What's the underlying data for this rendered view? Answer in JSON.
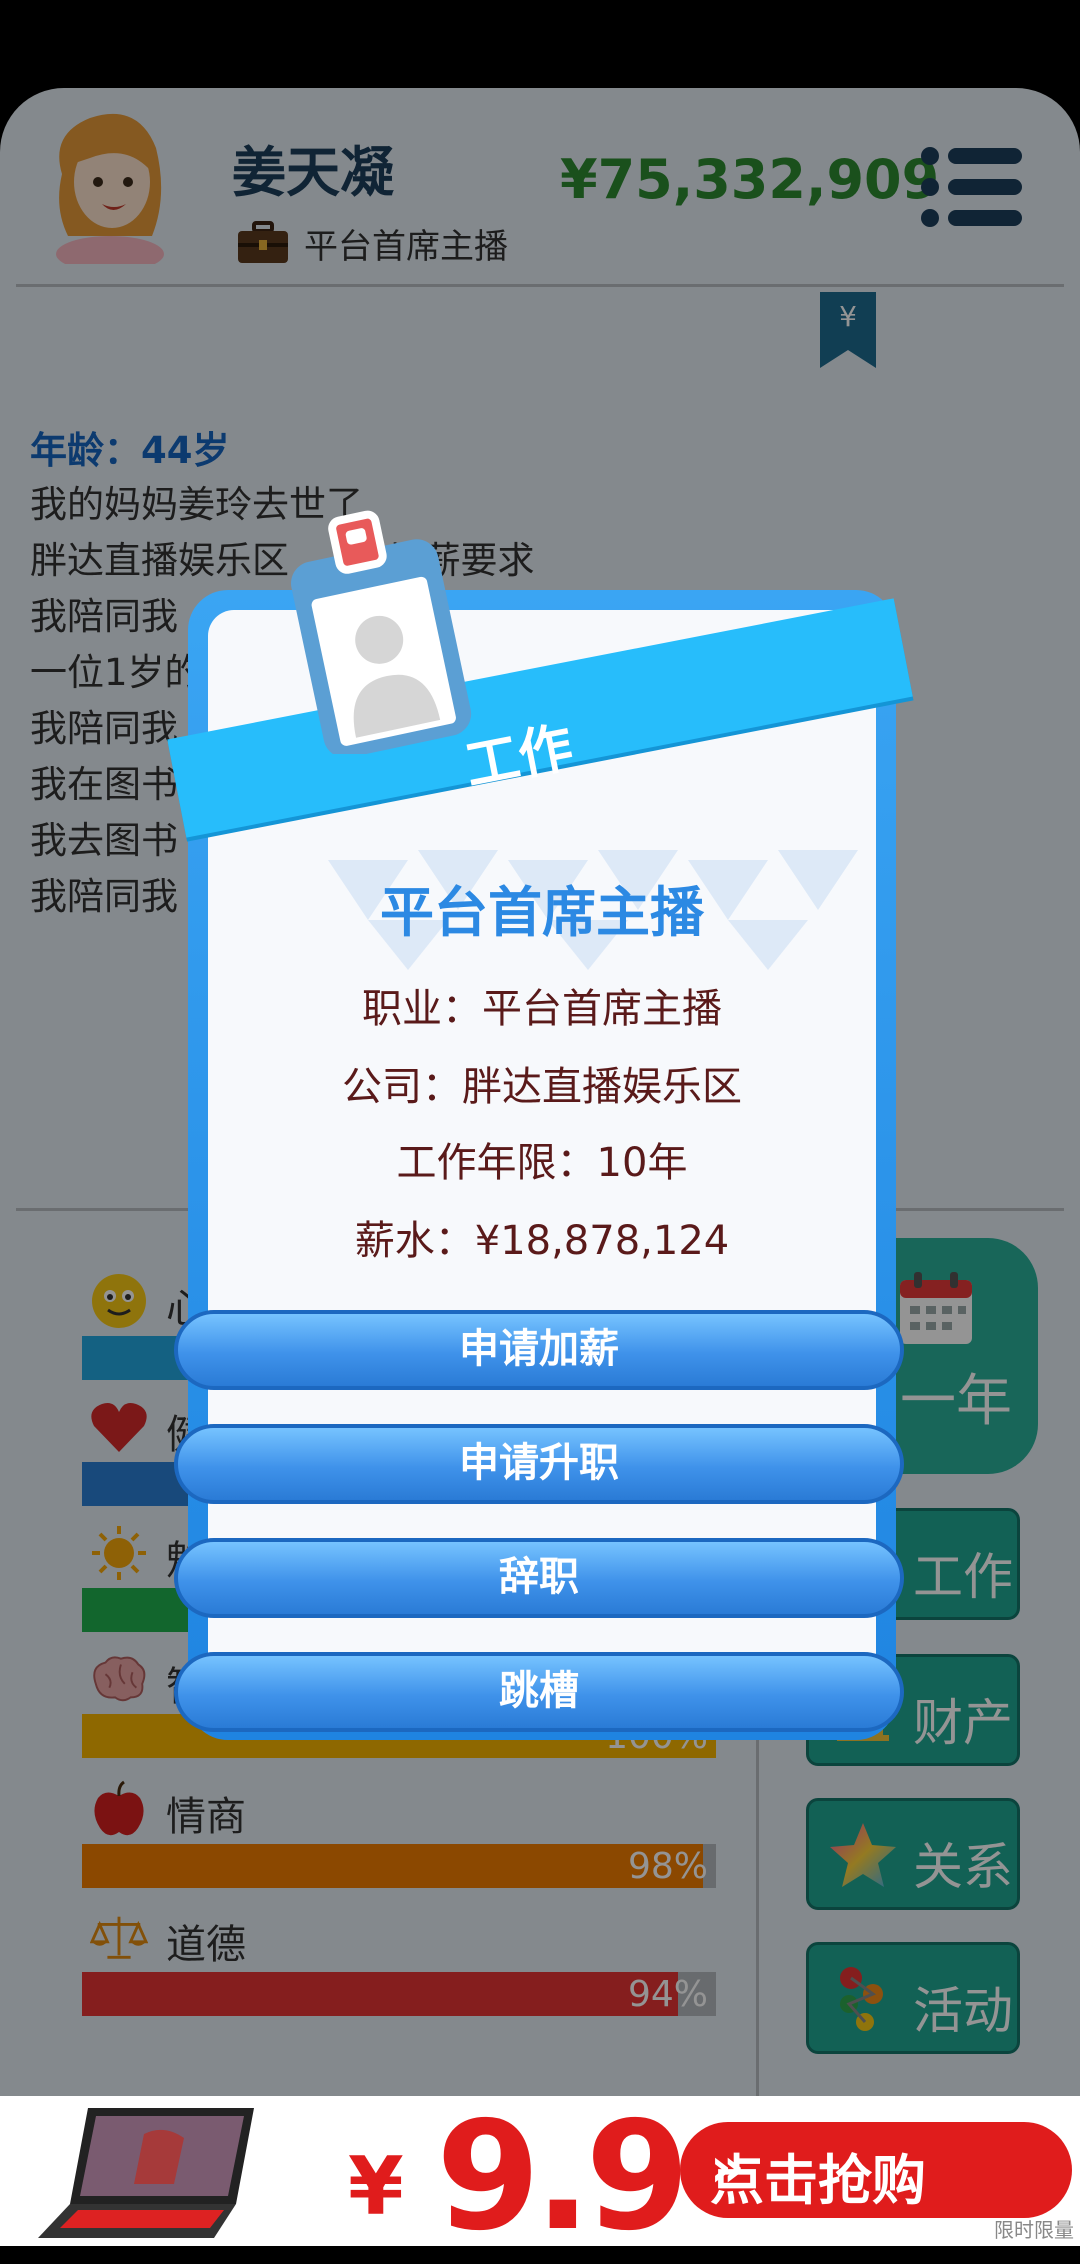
{
  "header": {
    "name": "姜天凝",
    "job_title": "平台首席主播",
    "money": "¥75,332,909"
  },
  "log": {
    "age_line": "年龄：44岁",
    "entries": [
      "我的妈妈姜玲去世了",
      "胖达直播娱乐区 … 的加薪要求",
      "我陪同我 … 兽猛霸天真的太猛",
      "一位1岁的 … 努力照顾好他的",
      "我陪同我 … 的练习了好一会儿",
      "我在图书 … 来股市发展良好，",
      "我去图书",
      "我陪同我 … 小猪跑的可真快"
    ]
  },
  "stats": [
    {
      "label": "心情",
      "value": 100,
      "color": "#24a7e0",
      "icon": "smiley-icon"
    },
    {
      "label": "健康",
      "value": 100,
      "color": "#2a7fd4",
      "icon": "heart-icon"
    },
    {
      "label": "魅力",
      "value": 100,
      "color": "#20b04e",
      "icon": "sun-icon"
    },
    {
      "label": "智商",
      "value": 100,
      "color": "#f5b400",
      "pct_label": "100%",
      "icon": "brain-icon"
    },
    {
      "label": "情商",
      "value": 98,
      "color": "#f07c00",
      "pct_label": "98%",
      "icon": "apple-icon"
    },
    {
      "label": "道德",
      "value": 94,
      "color": "#e53535",
      "pct_label": "94%",
      "icon": "scale-icon"
    }
  ],
  "side": {
    "next_year": "一年",
    "work": "工作",
    "property": "财产",
    "relations": "关系",
    "activity": "活动"
  },
  "modal": {
    "title": "工作",
    "job": "平台首席主播",
    "occupation": "职业：平台首席主播",
    "company": "公司：胖达直播娱乐区",
    "years": "工作年限：10年",
    "salary": "薪水：¥18,878,124",
    "buttons": [
      "申请加薪",
      "申请升职",
      "辞职",
      "跳槽"
    ]
  },
  "ad": {
    "yen": "¥",
    "price": "9.9",
    "buy": "点击抢购",
    "arrows": "»",
    "limit": "限时限量"
  },
  "colors": {
    "money": "#2e8b31",
    "accent": "#2c89e3",
    "teal": "#20a893",
    "ad_red": "#e01c1c"
  }
}
